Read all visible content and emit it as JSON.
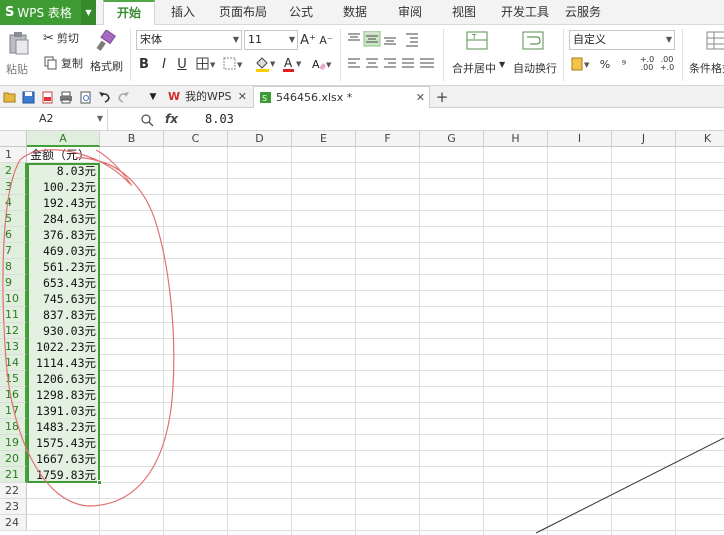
{
  "app": {
    "title": "WPS 表格",
    "logo": "S"
  },
  "menu": {
    "tabs": [
      "开始",
      "插入",
      "页面布局",
      "公式",
      "数据",
      "审阅",
      "视图",
      "开发工具",
      "云服务"
    ],
    "active": "开始"
  },
  "ribbon": {
    "paste": "粘贴",
    "cut": "剪切",
    "copy": "复制",
    "format_painter": "格式刷",
    "font_name": "宋体",
    "font_size": "11",
    "bold": "B",
    "italic": "I",
    "underline": "U",
    "font_color_letter": "A",
    "merge_center": "合并居中",
    "wrap_text": "自动换行",
    "number_format": "自定义",
    "percent": "%",
    "thousands": "⁹",
    "dec_inc": "+.0 .00",
    "dec_dec": ".00 +.0",
    "conditional_format": "条件格式",
    "font_grow": "A⁺",
    "font_shrink": "A⁻"
  },
  "doc_tabs": [
    {
      "label": "我的WPS",
      "active": false
    },
    {
      "label": "546456.xlsx *",
      "active": true
    }
  ],
  "add_tab": "+",
  "formula_bar": {
    "cell_ref": "A2",
    "fx": "fx",
    "value": "8.03"
  },
  "columns": [
    "A",
    "B",
    "C",
    "D",
    "E",
    "F",
    "G",
    "H",
    "I",
    "J",
    "K"
  ],
  "rows": [
    "1",
    "2",
    "3",
    "4",
    "5",
    "6",
    "7",
    "8",
    "9",
    "10",
    "11",
    "12",
    "13",
    "14",
    "15",
    "16",
    "17",
    "18",
    "19",
    "20",
    "21",
    "22",
    "23",
    "24"
  ],
  "column_a": [
    "金额（元）",
    "8.03元",
    "100.23元",
    "192.43元",
    "284.63元",
    "376.83元",
    "469.03元",
    "561.23元",
    "653.43元",
    "745.63元",
    "837.83元",
    "930.03元",
    "1022.23元",
    "1114.43元",
    "1206.63元",
    "1298.83元",
    "1391.03元",
    "1483.23元",
    "1575.43元",
    "1667.63元",
    "1759.83元"
  ],
  "colors": {
    "brand": "#3e9a33",
    "selection": "#3f9b35",
    "annotation": "#e07070"
  }
}
